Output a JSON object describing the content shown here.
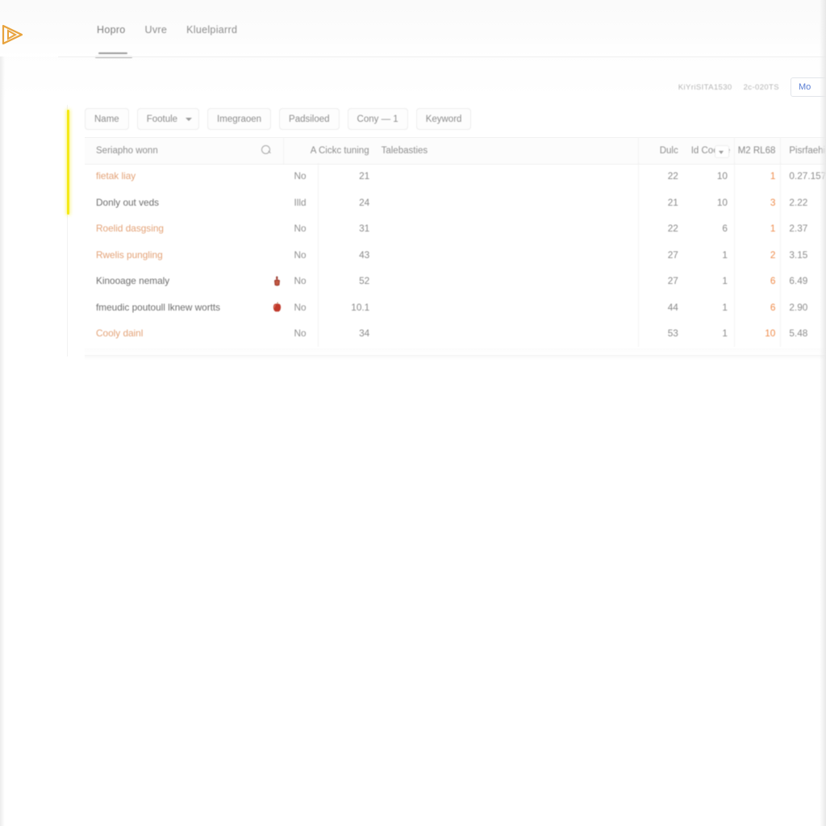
{
  "brand": {
    "logo_icon": "play-triangle-logo",
    "logo_color": "#e8a33d",
    "accent_color": "#f5ea16",
    "highlight_color": "#e3a277",
    "link_color": "#5b7fd4"
  },
  "nav": {
    "items": [
      {
        "label": "Hopro",
        "active": true
      },
      {
        "label": "Uvre",
        "active": false
      },
      {
        "label": "Kluelpiarrd",
        "active": false
      }
    ]
  },
  "meta": {
    "code": "KiYriSITA1530",
    "ref": "2c-020TS",
    "button_label": "Mo"
  },
  "filters": {
    "pills": [
      {
        "label": "Name",
        "caret": false
      },
      {
        "label": "Footule",
        "caret": true
      },
      {
        "label": "Imegraoen",
        "caret": false
      },
      {
        "label": "Padsiloed",
        "caret": false
      },
      {
        "label": "Cony — 1",
        "caret": false
      },
      {
        "label": "Keyword",
        "caret": false
      }
    ]
  },
  "table": {
    "search": {
      "placeholder": "Seriapho wonn",
      "icon": "search-icon"
    },
    "headers": [
      "A Cickc tuning",
      "Talebasties",
      "Dulc",
      "Id Cooice",
      "M2 RL68",
      "Pisrfaehio"
    ],
    "header_caret_column": "Id Cooice",
    "rows": [
      {
        "name": "fietak liay",
        "highlight": true,
        "icon": null,
        "flag": "No",
        "n1": "21",
        "n2": "22",
        "n3": "10",
        "n4": "1",
        "n5": "0.27.157"
      },
      {
        "name": "Donly out veds",
        "highlight": false,
        "icon": null,
        "flag": "Illd",
        "n1": "24",
        "n2": "21",
        "n3": "10",
        "n4": "3",
        "n5": "2.22"
      },
      {
        "name": "Roelid dasgsing",
        "highlight": true,
        "icon": null,
        "flag": "No",
        "n1": "31",
        "n2": "22",
        "n3": "6",
        "n4": "1",
        "n5": "2.37"
      },
      {
        "name": "Rwelis pungling",
        "highlight": true,
        "icon": null,
        "flag": "No",
        "n1": "43",
        "n2": "27",
        "n3": "1",
        "n4": "2",
        "n5": "3.15"
      },
      {
        "name": "Kinooage nemaly",
        "highlight": false,
        "icon": "red-badge-icon",
        "flag": "No",
        "n1": "52",
        "n2": "27",
        "n3": "1",
        "n4": "6",
        "n5": "6.49"
      },
      {
        "name": "fmeudic poutoull lknew wortts",
        "highlight": false,
        "icon": "red-apple-icon",
        "flag": "No",
        "n1": "10.1",
        "n2": "44",
        "n3": "1",
        "n4": "6",
        "n5": "2.90"
      },
      {
        "name": "Cooly dainl",
        "highlight": true,
        "icon": null,
        "flag": "No",
        "n1": "34",
        "n2": "53",
        "n3": "1",
        "n4": "10",
        "n5": "5.48"
      }
    ]
  }
}
